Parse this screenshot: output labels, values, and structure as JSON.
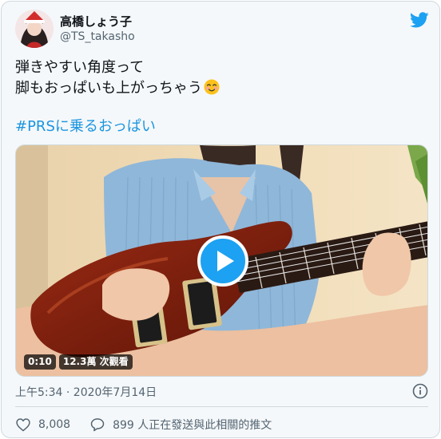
{
  "author": {
    "display_name": "高橋しょう子",
    "handle": "@TS_takasho"
  },
  "tweet": {
    "line1": "弾きやすい角度って",
    "line2": "脚もおっぱいも上がっちゃう",
    "hashtag": "#PRS",
    "hashtag_suffix": "に乗るおっぱい"
  },
  "video": {
    "duration": "0:10",
    "views": "12.3萬 次觀看"
  },
  "meta": {
    "timestamp": "上午5:34 · 2020年7月14日"
  },
  "actions": {
    "likes": "8,008",
    "replies_label": "899 人正在發送與此相關的推文"
  },
  "colors": {
    "brand": "#1da1f2",
    "hashtag": "#1b95e0",
    "muted": "#536471",
    "card_bg": "#f5f8fa"
  },
  "icons": [
    "twitter-bird-icon",
    "play-icon",
    "smiling-face-emoji",
    "info-icon",
    "heart-icon",
    "reply-bubble-icon"
  ]
}
